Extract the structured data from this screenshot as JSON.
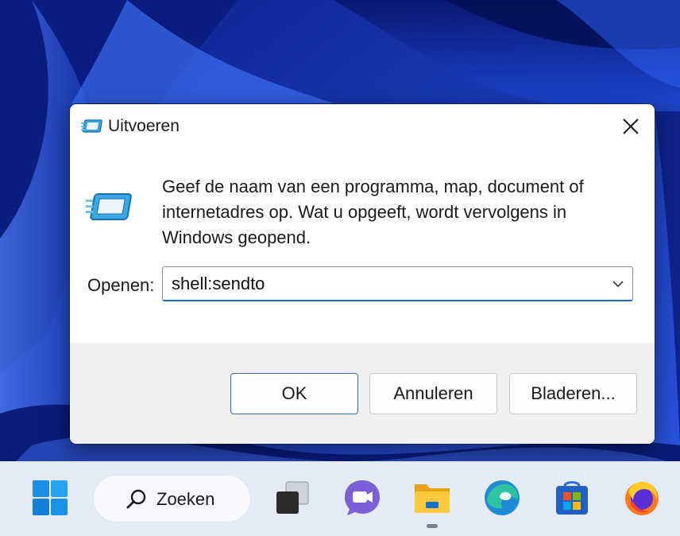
{
  "dialog": {
    "title": "Uitvoeren",
    "description": "Geef de naam van een programma, map, document of internetadres op. Wat u opgeeft, wordt vervolgens in Windows geopend.",
    "open_label": "Openen:",
    "input_value": "shell:sendto",
    "buttons": {
      "ok": "OK",
      "cancel": "Annuleren",
      "browse": "Bladeren..."
    }
  },
  "taskbar": {
    "search_label": "Zoeken",
    "items": [
      {
        "name": "start-icon"
      },
      {
        "name": "task-view-icon"
      },
      {
        "name": "teams-chat-icon"
      },
      {
        "name": "file-explorer-icon",
        "active": true
      },
      {
        "name": "edge-icon"
      },
      {
        "name": "microsoft-store-icon"
      },
      {
        "name": "firefox-icon"
      }
    ]
  },
  "colors": {
    "accent": "#1f6bc4",
    "taskbar": "#e5ebf6",
    "footer": "#f0f0f0"
  }
}
